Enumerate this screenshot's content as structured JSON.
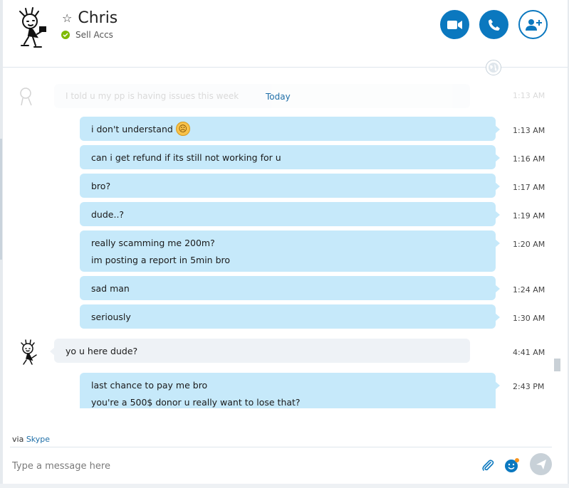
{
  "header": {
    "contact_name": "Chris",
    "status_text": "Sell Accs",
    "status_color": "#7fba00",
    "accent_color": "#0b78bf",
    "icons": [
      "star-icon",
      "video-call-icon",
      "phone-icon",
      "add-contact-icon",
      "globe-icon"
    ]
  },
  "conversation": {
    "faded_message": {
      "text": "I told u my pp is having issues this week",
      "time": "1:13 AM"
    },
    "date_separator": "Today",
    "messages": [
      {
        "direction": "out",
        "lines": [
          "i don't understand"
        ],
        "emoji": "sad-face-emoji",
        "time": "1:13 AM"
      },
      {
        "direction": "out",
        "lines": [
          "can i get refund if its still not working for u"
        ],
        "time": "1:16 AM"
      },
      {
        "direction": "out",
        "lines": [
          "bro?"
        ],
        "time": "1:17 AM"
      },
      {
        "direction": "out",
        "lines": [
          "dude..?"
        ],
        "time": "1:19 AM"
      },
      {
        "direction": "out",
        "lines": [
          "really scamming me 200m?",
          "im posting a report in 5min bro"
        ],
        "time": "1:20 AM"
      },
      {
        "direction": "out",
        "lines": [
          "sad man"
        ],
        "time": "1:24 AM"
      },
      {
        "direction": "out",
        "lines": [
          "seriously"
        ],
        "time": "1:30 AM"
      },
      {
        "direction": "in",
        "lines": [
          "yo u here dude?"
        ],
        "time": "4:41 AM"
      },
      {
        "direction": "out",
        "lines": [
          "last chance to pay me bro",
          "you're a 500$ donor u really want to lose that?"
        ],
        "time": "2:43 PM"
      }
    ],
    "bubble_colors": {
      "out": "#c6e9fa",
      "in": "#eef2f6"
    }
  },
  "footer": {
    "via_prefix": "via",
    "via_link": "Skype",
    "compose_placeholder": "Type a message here",
    "icons": [
      "paperclip-icon",
      "emoticon-icon",
      "send-icon"
    ]
  }
}
